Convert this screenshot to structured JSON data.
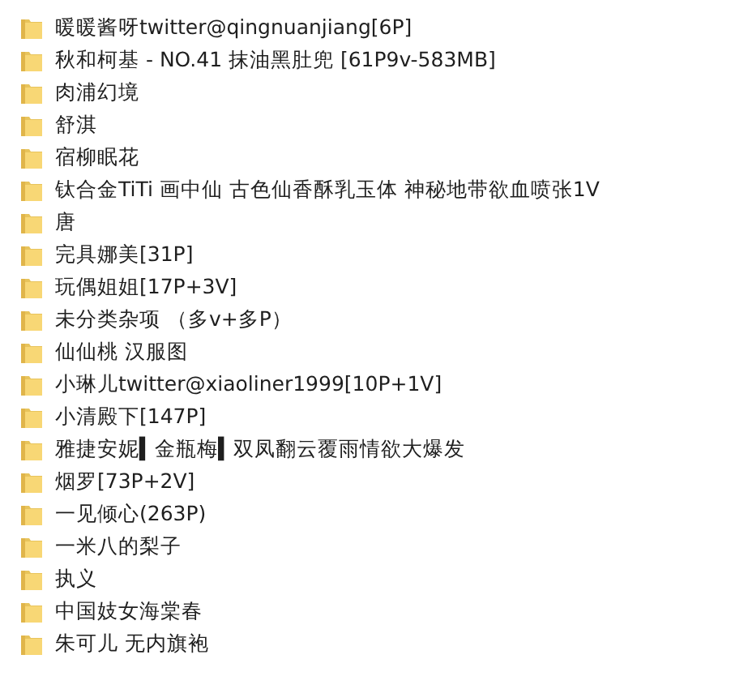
{
  "folders": [
    {
      "name": "暖暖酱呀twitter@qingnuanjiang[6P]"
    },
    {
      "name": "秋和柯基 - NO.41 抹油黑肚兜 [61P9v-583MB]"
    },
    {
      "name": "肉浦幻境"
    },
    {
      "name": "舒淇"
    },
    {
      "name": "宿柳眠花"
    },
    {
      "name": "钛合金TiTi 画中仙 古色仙香酥乳玉体 神秘地带欲血喷张1V"
    },
    {
      "name": "唐"
    },
    {
      "name": "完具娜美[31P]"
    },
    {
      "name": "玩偶姐姐[17P+3V]"
    },
    {
      "name": "未分类杂项 （多v+多P）"
    },
    {
      "name": "仙仙桃  汉服图"
    },
    {
      "name": "小琳儿twitter@xiaoliner1999[10P+1V]"
    },
    {
      "name": "小清殿下[147P]"
    },
    {
      "name": "雅捷安妮▍金瓶梅▍双凤翻云覆雨情欲大爆发"
    },
    {
      "name": "烟罗[73P+2V]"
    },
    {
      "name": "一见倾心(263P)"
    },
    {
      "name": "一米八的梨子"
    },
    {
      "name": "执义"
    },
    {
      "name": "中国妓女海棠春"
    },
    {
      "name": "朱可儿 无内旗袍"
    }
  ]
}
